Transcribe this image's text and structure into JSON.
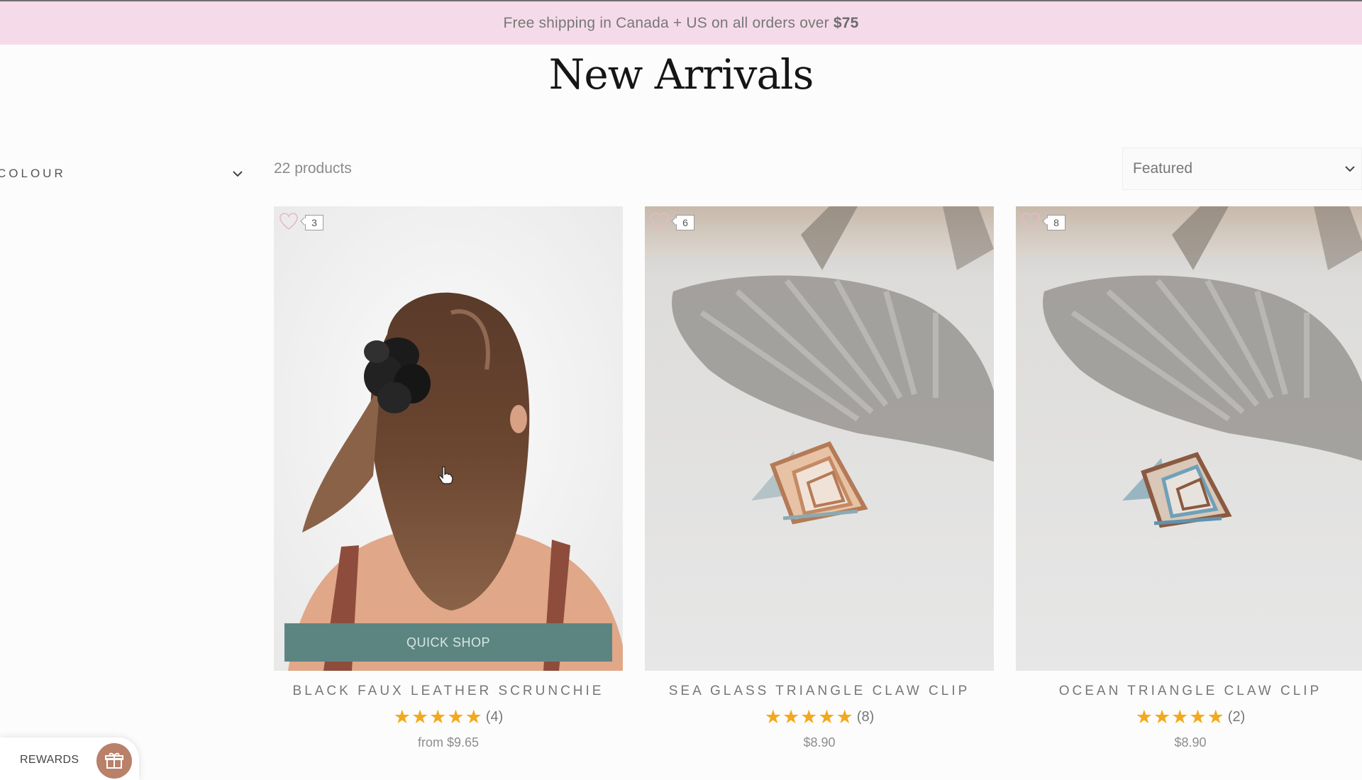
{
  "announcement": {
    "text": "Free shipping in Canada + US on all orders over",
    "amount": "$75"
  },
  "page": {
    "title": "New Arrivals"
  },
  "filters": {
    "colour_label": "COLOUR",
    "colour_icon": "chevron-down-icon"
  },
  "collection": {
    "count_text": "22 products",
    "sort_value": "Featured"
  },
  "products": [
    {
      "wishlist_count": "3",
      "name": "BLACK FAUX LEATHER SCRUNCHIE",
      "stars": "★★★★★",
      "rating_count": "(4)",
      "price": "from $9.65",
      "quick_shop": "QUICK SHOP"
    },
    {
      "wishlist_count": "6",
      "name": "SEA GLASS TRIANGLE CLAW CLIP",
      "stars": "★★★★★",
      "rating_count": "(8)",
      "price": "$8.90"
    },
    {
      "wishlist_count": "8",
      "name": "OCEAN TRIANGLE CLAW CLIP",
      "stars": "★★★★★",
      "rating_count": "(2)",
      "price": "$8.90"
    }
  ],
  "rewards": {
    "label": "REWARDS",
    "icon": "gift-icon"
  },
  "colors": {
    "announcement_bg": "#f5dbe9",
    "quick_shop_bg": "#5c8582",
    "star": "#f3a91d",
    "rewards_icon_bg": "#b9806a"
  }
}
